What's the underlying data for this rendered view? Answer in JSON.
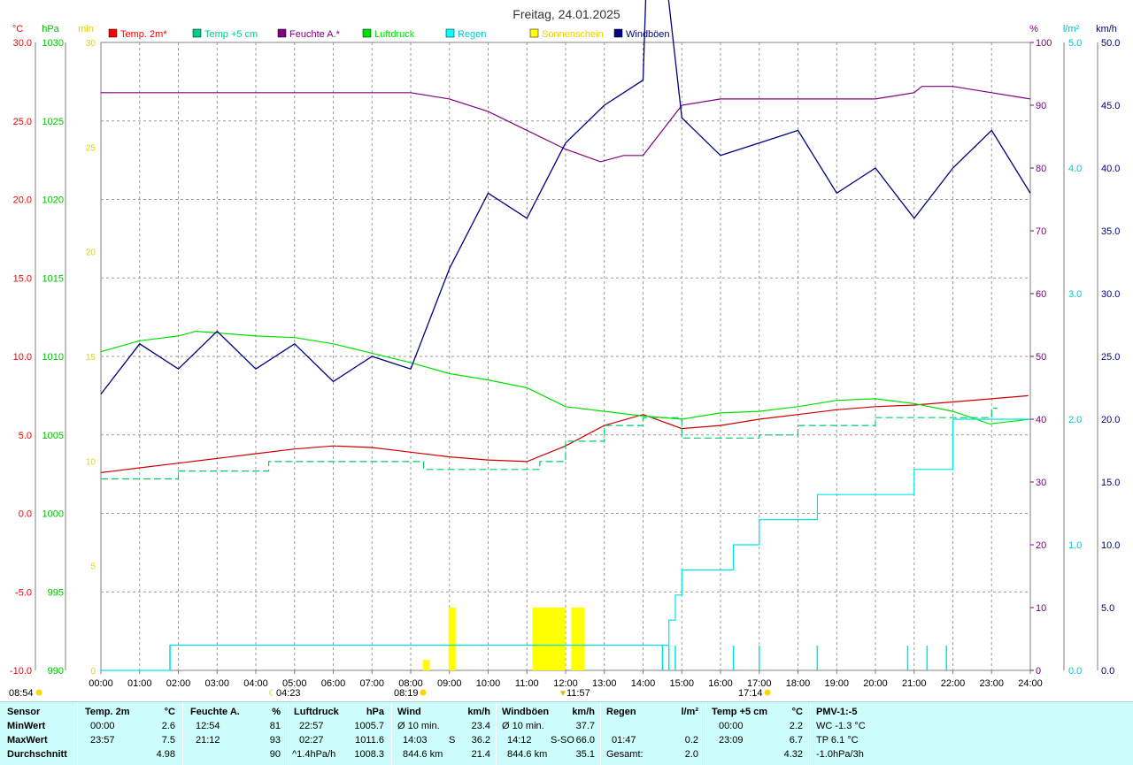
{
  "title": "Freitag, 24.01.2025",
  "units": {
    "temp": "°C",
    "pressure": "hPa",
    "sun": "min",
    "humidity": "%",
    "rain": "l/m²",
    "wind": "km/h"
  },
  "legend": [
    {
      "label": "Temp. 2m*",
      "color": "#ff0000"
    },
    {
      "label": "Temp +5 cm",
      "color": "#00cc88"
    },
    {
      "label": "Feuchte A.*",
      "color": "#800080"
    },
    {
      "label": "Luftdruck",
      "color": "#00e000"
    },
    {
      "label": "Regen",
      "color": "#00ffff"
    },
    {
      "label": "Sonnenschein",
      "color": "#ffff00"
    },
    {
      "label": "Windböen",
      "color": "#000080"
    }
  ],
  "axes": {
    "temp_ticks": [
      "30.0",
      "25.0",
      "20.0",
      "15.0",
      "10.0",
      "5.0",
      "0.0",
      "-5.0",
      "-10.0"
    ],
    "pressure_ticks": [
      "1030",
      "1025",
      "1020",
      "1015",
      "1010",
      "1005",
      "1000",
      "995",
      "990"
    ],
    "sun_ticks": [
      "30",
      "25",
      "20",
      "15",
      "10",
      "5",
      "0"
    ],
    "humidity_ticks": [
      "100",
      "90",
      "80",
      "70",
      "60",
      "50",
      "40",
      "30",
      "20",
      "10",
      "0"
    ],
    "rain_ticks": [
      "5.0",
      "4.0",
      "3.0",
      "2.0",
      "1.0",
      "0.0"
    ],
    "wind_ticks": [
      "50.0",
      "45.0",
      "40.0",
      "35.0",
      "30.0",
      "25.0",
      "20.0",
      "15.0",
      "10.0",
      "5.0",
      "0.0"
    ],
    "time_ticks": [
      "00:00",
      "01:00",
      "02:00",
      "03:00",
      "04:00",
      "05:00",
      "06:00",
      "07:00",
      "08:00",
      "09:00",
      "10:00",
      "11:00",
      "12:00",
      "13:00",
      "14:00",
      "15:00",
      "16:00",
      "17:00",
      "18:00",
      "19:00",
      "20:00",
      "21:00",
      "22:00",
      "23:00",
      "24:00"
    ]
  },
  "sun_marks": {
    "sunrise": "08:19",
    "sunset": "17:14",
    "noon": "11:57",
    "daylength": "08:54",
    "moon": "04:23"
  },
  "chart_data": {
    "type": "line",
    "title": "Freitag, 24.01.2025",
    "x_range": [
      "00:00",
      "24:00"
    ],
    "series": [
      {
        "name": "Temp. 2m*",
        "unit": "°C",
        "ylim": [
          -10,
          30
        ],
        "x": [
          "00:00",
          "01:00",
          "02:00",
          "03:00",
          "04:00",
          "05:00",
          "06:00",
          "07:00",
          "08:00",
          "09:00",
          "10:00",
          "11:00",
          "12:00",
          "13:00",
          "14:00",
          "15:00",
          "16:00",
          "17:00",
          "18:00",
          "19:00",
          "20:00",
          "21:00",
          "22:00",
          "23:00",
          "23:57"
        ],
        "values": [
          2.6,
          2.9,
          3.2,
          3.5,
          3.8,
          4.1,
          4.3,
          4.2,
          3.9,
          3.6,
          3.4,
          3.3,
          4.3,
          5.6,
          6.3,
          5.4,
          5.6,
          6.0,
          6.3,
          6.6,
          6.8,
          6.9,
          7.1,
          7.3,
          7.5
        ]
      },
      {
        "name": "Temp +5 cm",
        "unit": "°C",
        "ylim": [
          -10,
          30
        ],
        "x": [
          "00:00",
          "01:00",
          "01:50",
          "02:00",
          "03:00",
          "04:00",
          "04:20",
          "05:00",
          "06:00",
          "07:00",
          "08:00",
          "08:20",
          "09:00",
          "10:00",
          "11:00",
          "11:20",
          "12:00",
          "13:00",
          "14:00",
          "15:00",
          "16:00",
          "17:00",
          "18:00",
          "19:00",
          "20:00",
          "21:00",
          "22:00",
          "23:00",
          "23:09"
        ],
        "values": [
          2.2,
          2.2,
          2.2,
          2.7,
          2.7,
          2.7,
          3.3,
          3.3,
          3.3,
          3.3,
          3.3,
          2.8,
          2.8,
          2.8,
          2.8,
          3.3,
          4.6,
          5.6,
          6.1,
          4.8,
          4.8,
          5.0,
          5.6,
          5.6,
          6.1,
          6.1,
          6.1,
          6.7,
          6.7
        ]
      },
      {
        "name": "Feuchte A.*",
        "unit": "%",
        "ylim": [
          0,
          100
        ],
        "x": [
          "00:00",
          "01:00",
          "02:00",
          "03:00",
          "04:00",
          "05:00",
          "06:00",
          "07:00",
          "08:00",
          "09:00",
          "10:00",
          "11:00",
          "12:00",
          "12:54",
          "13:30",
          "14:00",
          "14:30",
          "15:00",
          "16:00",
          "17:00",
          "18:00",
          "19:00",
          "20:00",
          "21:00",
          "21:12",
          "22:00",
          "23:00",
          "24:00"
        ],
        "values": [
          92,
          92,
          92,
          92,
          92,
          92,
          92,
          92,
          92,
          91,
          89,
          86,
          83,
          81,
          82,
          82,
          86,
          90,
          91,
          91,
          91,
          91,
          91,
          92,
          93,
          93,
          92,
          91
        ]
      },
      {
        "name": "Luftdruck",
        "unit": "hPa",
        "ylim": [
          990,
          1030
        ],
        "x": [
          "00:00",
          "01:00",
          "02:00",
          "02:27",
          "03:00",
          "04:00",
          "05:00",
          "06:00",
          "07:00",
          "08:00",
          "09:00",
          "10:00",
          "11:00",
          "12:00",
          "13:00",
          "14:00",
          "15:00",
          "16:00",
          "17:00",
          "18:00",
          "19:00",
          "20:00",
          "21:00",
          "22:00",
          "22:57",
          "24:00"
        ],
        "values": [
          1010.3,
          1011.0,
          1011.3,
          1011.6,
          1011.5,
          1011.3,
          1011.2,
          1010.8,
          1010.2,
          1009.6,
          1008.9,
          1008.5,
          1008.0,
          1006.8,
          1006.5,
          1006.2,
          1006.0,
          1006.4,
          1006.5,
          1006.8,
          1007.2,
          1007.3,
          1007.0,
          1006.5,
          1005.7,
          1006.0
        ]
      },
      {
        "name": "Regen",
        "unit": "l/m²",
        "ylim": [
          0,
          5
        ],
        "x": [
          "00:00",
          "01:47",
          "14:30",
          "14:40",
          "14:50",
          "15:00",
          "16:00",
          "16:20",
          "17:00",
          "17:50",
          "18:30",
          "19:00",
          "20:00",
          "21:00",
          "22:00",
          "24:00"
        ],
        "values": [
          0.0,
          0.2,
          0.2,
          0.4,
          0.6,
          0.8,
          0.8,
          1.0,
          1.2,
          1.2,
          1.4,
          1.4,
          1.4,
          1.6,
          2.0,
          2.0
        ]
      },
      {
        "name": "Windböen",
        "unit": "km/h",
        "ylim": [
          0,
          50
        ],
        "x": [
          "00:00",
          "01:00",
          "02:00",
          "03:00",
          "04:00",
          "05:00",
          "06:00",
          "07:00",
          "08:00",
          "09:00",
          "10:00",
          "11:00",
          "12:00",
          "13:00",
          "14:00",
          "14:12",
          "15:00",
          "16:00",
          "17:00",
          "18:00",
          "19:00",
          "20:00",
          "21:00",
          "22:00",
          "23:00",
          "24:00"
        ],
        "values": [
          22,
          26,
          24,
          27,
          24,
          26,
          23,
          25,
          24,
          32,
          38,
          36,
          42,
          45,
          47,
          66,
          44,
          41,
          42,
          43,
          38,
          40,
          36,
          40,
          43,
          38
        ]
      }
    ],
    "sunshine_bars": {
      "name": "Sonnenschein",
      "unit": "min",
      "ylim": [
        0,
        30
      ],
      "x": [
        "08:20",
        "09:00",
        "11:10",
        "11:20",
        "11:30",
        "11:40",
        "11:50",
        "12:10",
        "12:20"
      ],
      "values": [
        0.5,
        3,
        3,
        3,
        3,
        3,
        3,
        3,
        3
      ]
    }
  },
  "stats": {
    "sensor": {
      "header": "Sensor",
      "rows": [
        "MinWert",
        "MaxWert",
        "Durchschnitt"
      ]
    },
    "temp2m": {
      "header": "Temp. 2m",
      "unit": "°C",
      "rows": [
        {
          "time": "00:00",
          "value": "2.6"
        },
        {
          "time": "23:57",
          "value": "7.5"
        },
        {
          "time": "",
          "value": "4.98"
        }
      ]
    },
    "humidity": {
      "header": "Feuchte A.",
      "unit": "%",
      "rows": [
        {
          "time": "12:54",
          "value": "81"
        },
        {
          "time": "21:12",
          "value": "93"
        },
        {
          "time": "",
          "value": "90"
        }
      ]
    },
    "pressure": {
      "header": "Luftdruck",
      "unit": "hPa",
      "rows": [
        {
          "time": "22:57",
          "value": "1005.7"
        },
        {
          "time": "02:27",
          "value": "1011.6"
        },
        {
          "time": "^1.4hPa/h",
          "value": "1008.3"
        }
      ]
    },
    "wind": {
      "header": "Wind",
      "unit": "km/h",
      "rows": [
        {
          "time": "Ø 10 min.",
          "dir": "",
          "value": "23.4"
        },
        {
          "time": "14:03",
          "dir": "S",
          "value": "36.2"
        },
        {
          "time": "844.6 km",
          "dir": "",
          "value": "21.4"
        }
      ]
    },
    "gusts": {
      "header": "Windböen",
      "unit": "km/h",
      "rows": [
        {
          "time": "Ø 10 min.",
          "dir": "",
          "value": "37.7"
        },
        {
          "time": "14:12",
          "dir": "S-SO",
          "value": "66.0"
        },
        {
          "time": "844.6 km",
          "dir": "",
          "value": "35.1"
        }
      ]
    },
    "rain": {
      "header": "Regen",
      "unit": "l/m²",
      "rows": [
        {
          "time": "",
          "value": ""
        },
        {
          "time": "01:47",
          "value": "0.2"
        },
        {
          "time": "Gesamt:",
          "value": "2.0"
        }
      ]
    },
    "temp5cm": {
      "header": "Temp +5 cm",
      "unit": "°C",
      "rows": [
        {
          "time": "00:00",
          "value": "2.2"
        },
        {
          "time": "23:09",
          "value": "6.7"
        },
        {
          "time": "",
          "value": "4.32"
        }
      ]
    },
    "pmv": {
      "header": "PMV-1:-5",
      "rows": [
        "WC -1.3 °C",
        "TP 6.1 °C",
        "-1.0hPa/3h"
      ]
    }
  }
}
